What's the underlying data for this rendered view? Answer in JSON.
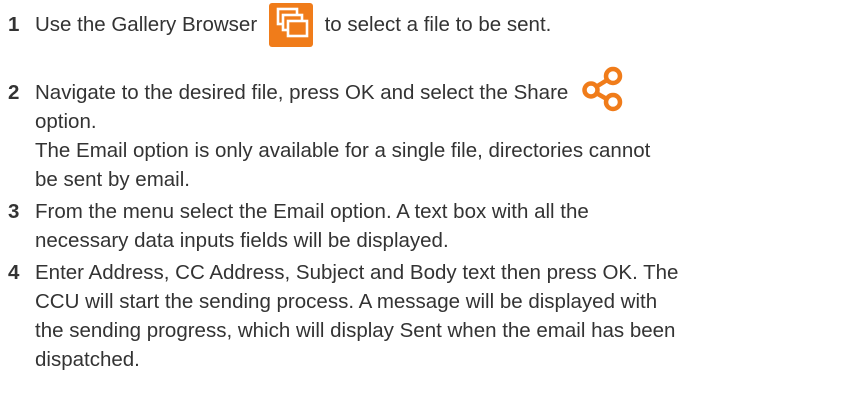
{
  "steps": [
    {
      "number": "1",
      "text_before_icon": "Use the Gallery Browser",
      "icon": "gallery-browser-icon",
      "text_after_icon": "to select a file to be sent."
    },
    {
      "number": "2",
      "text_before_icon": "Navigate to the desired file, press OK and select the Share",
      "icon": "share-icon",
      "line2": "option.",
      "note_line1": "The Email option is only available for a single file, directories cannot",
      "note_line2": "be sent by email."
    },
    {
      "number": "3",
      "line1": "From the menu select the Email option. A text box with all the",
      "line2": "necessary data inputs fields will be displayed."
    },
    {
      "number": "4",
      "line1": "Enter Address, CC Address, Subject and Body text then press OK.  The",
      "line2": "CCU will start the sending process. A message will be displayed with",
      "line3": "the sending progress, which will display Sent when the email has been",
      "line4": "dispatched."
    }
  ],
  "colors": {
    "accent": "#f07c1a",
    "text": "#333333"
  }
}
